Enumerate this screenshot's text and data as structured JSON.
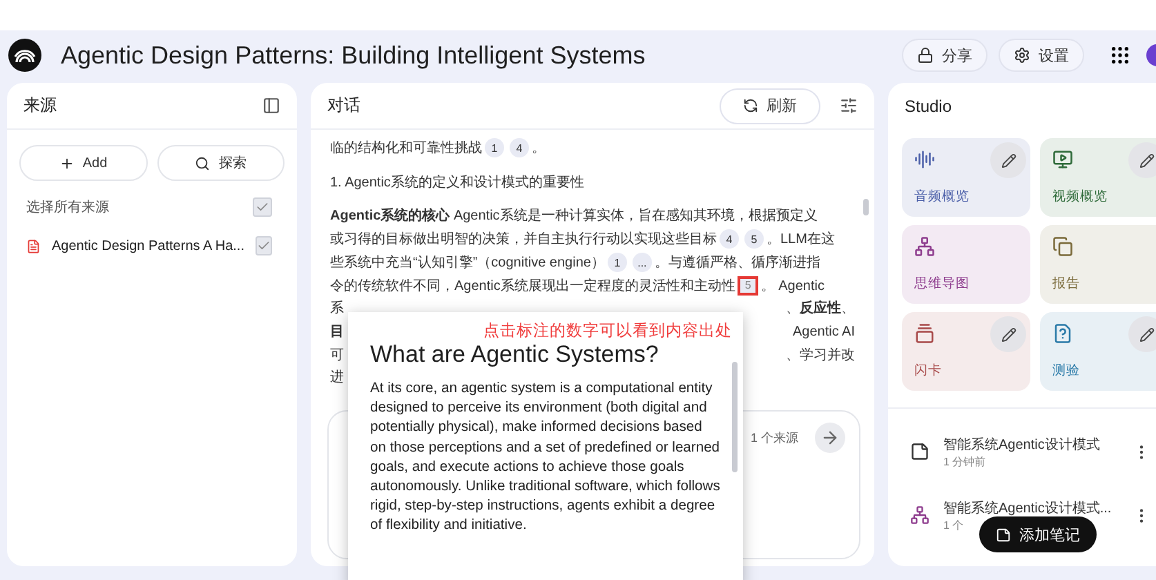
{
  "header": {
    "title": "Agentic Design Patterns: Building Intelligent Systems",
    "actions": [
      {
        "kind": "share",
        "label": "分享"
      },
      {
        "kind": "settings",
        "label": "设置"
      }
    ]
  },
  "sources": {
    "title": "来源",
    "buttons": [
      {
        "kind": "add",
        "label": "Add"
      },
      {
        "kind": "discover",
        "label": "探索"
      }
    ],
    "select_all": {
      "label": "选择所有来源",
      "checked": true
    },
    "items": [
      {
        "name": "Agentic Design Patterns A Ha...",
        "checked": true
      }
    ]
  },
  "chat": {
    "title": "对话",
    "refresh": "刷新",
    "lines": [
      {
        "kind": "line",
        "segments": [
          {
            "kind": "text",
            "text": "临的结构化和可靠性挑战"
          },
          {
            "kind": "cite",
            "label": "1",
            "annotated": false
          },
          {
            "kind": "cite",
            "label": "4",
            "annotated": false
          },
          {
            "kind": "text",
            "text": "。"
          }
        ]
      },
      {
        "kind": "heading",
        "segments": [
          {
            "kind": "text",
            "text": "1. Agentic系统的定义和设计模式的重要性"
          }
        ]
      },
      {
        "kind": "line",
        "segments": [
          {
            "kind": "text",
            "text": "**Agentic系统的核心** Agentic系统是一种计算实体，旨在感知其环境，根据预定义"
          }
        ]
      },
      {
        "kind": "line",
        "segments": [
          {
            "kind": "text",
            "text": "或习得的目标做出明智的决策，并自主执行行动以实现这些目标"
          },
          {
            "kind": "cite",
            "label": "4",
            "annotated": false
          },
          {
            "kind": "cite",
            "label": "5",
            "annotated": false
          },
          {
            "kind": "text",
            "text": "。LLM在这"
          }
        ]
      },
      {
        "kind": "line",
        "segments": [
          {
            "kind": "text",
            "text": "些系统中充当“认知引擎”（cognitive engine）"
          },
          {
            "kind": "cite",
            "label": "1",
            "annotated": false
          },
          {
            "kind": "cite",
            "label": "...",
            "annotated": false
          },
          {
            "kind": "text",
            "text": "。与遵循严格、循序渐进指"
          }
        ]
      },
      {
        "kind": "line",
        "segments": [
          {
            "kind": "text",
            "text": "令的传统软件不同，Agentic系统展现出一定程度的灵活性和主动性"
          },
          {
            "kind": "cite",
            "label": "5",
            "annotated": true
          },
          {
            "kind": "text",
            "text": "。 Agentic"
          }
        ]
      }
    ],
    "covered_lines": [
      {
        "left": "系",
        "right": "、**反应性**、"
      },
      {
        "left": "**目**",
        "right": "Agentic AI"
      },
      {
        "left": "可",
        "right": "、学习并改"
      },
      {
        "left": "进"
      }
    ],
    "composer": {
      "source_count": "1 个来源"
    }
  },
  "popup": {
    "annotation": "点击标注的数字可以看到内容出处",
    "title": "What are Agentic Systems?",
    "body": "At its core, an agentic system is a computational entity designed to perceive its environment (both digital and potentially physical), make informed decisions based on those perceptions and a set of predefined or learned goals, and execute actions to achieve those goals autonomously. Unlike traditional software, which follows rigid, step-by-step instructions, agents exhibit a degree of flexibility and initiative."
  },
  "studio": {
    "title": "Studio",
    "cards": [
      {
        "kind": "audio",
        "label": "音频概览",
        "color": "#4a5ea8",
        "editable": true
      },
      {
        "kind": "video",
        "label": "视频概览",
        "color": "#2f6b3a",
        "editable": true
      },
      {
        "kind": "mindmap",
        "label": "思维导图",
        "color": "#8e3d8e",
        "editable": false
      },
      {
        "kind": "report",
        "label": "报告",
        "color": "#7a6a3a",
        "editable": false
      },
      {
        "kind": "flashcard",
        "label": "闪卡",
        "color": "#a84a4a",
        "editable": true
      },
      {
        "kind": "quiz",
        "label": "测验",
        "color": "#2a7aa8",
        "editable": true
      }
    ],
    "notes": [
      {
        "kind": "note",
        "title": "智能系统Agentic设计模式",
        "subtitle": "1 分钟前"
      },
      {
        "kind": "mindmap",
        "title": "智能系统Agentic设计模式...",
        "subtitle": "1 个"
      }
    ],
    "add_note": "添加笔记"
  }
}
